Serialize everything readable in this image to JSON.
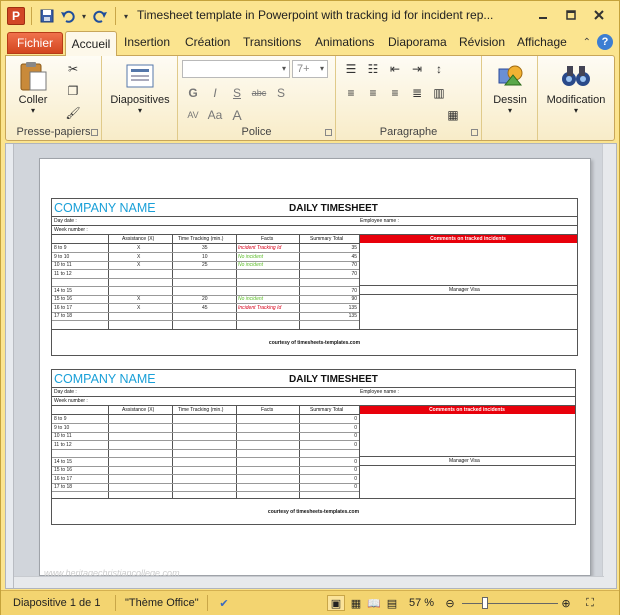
{
  "window": {
    "title": "Timesheet template in Powerpoint with tracking id for incident rep...",
    "app_logo": "P"
  },
  "qat": {
    "icons": [
      "save-icon",
      "undo-icon",
      "redo-icon",
      "customize-icon"
    ]
  },
  "tabs": {
    "fichier": "Fichier",
    "active": "Accueil",
    "items": [
      "Insertion",
      "Création",
      "Transitions",
      "Animations",
      "Diaporama",
      "Révision",
      "Affichage"
    ],
    "help": "?"
  },
  "ribbon": {
    "groups": {
      "clipboard": {
        "label": "Presse-papiers",
        "coller": "Coller"
      },
      "slides": {
        "diapositives": "Diapositives"
      },
      "font": {
        "label": "Police",
        "size": "7+",
        "letters": [
          "G",
          "I",
          "S",
          "abc",
          "S",
          "AV",
          "Aa"
        ]
      },
      "paragraph": {
        "label": "Paragraphe"
      },
      "drawing": {
        "dessin": "Dessin"
      },
      "editing": {
        "modification": "Modification"
      }
    }
  },
  "timesheet": {
    "company": "COMPANY NAME",
    "title": "DAILY TIMESHEET",
    "day_date": "Day date :",
    "week_number": "Week number :",
    "employee_name": "Employee name :",
    "columns": [
      "Assistance (X)",
      "Time Tracking (min.)",
      "Facts",
      "Summary Total"
    ],
    "comments_header": "Comments on tracked incidents",
    "manager_visa": "Manager Visa",
    "courtesy": "courtesy of timesheets-templates.com"
  },
  "sheet1": {
    "rows": [
      {
        "time": "8 to 9",
        "assist": "X",
        "tracking": "35",
        "fact": "Incident Tracking Id",
        "fact_color": "red",
        "total": "35"
      },
      {
        "time": "9 to 10",
        "assist": "X",
        "tracking": "10",
        "fact": "No incident",
        "fact_color": "green",
        "total": "45"
      },
      {
        "time": "10 to 11",
        "assist": "X",
        "tracking": "25",
        "fact": "No incident",
        "fact_color": "green",
        "total": "70"
      },
      {
        "time": "11 to 12",
        "assist": "",
        "tracking": "",
        "fact": "",
        "fact_color": "",
        "total": "70"
      },
      {
        "time": "",
        "assist": "",
        "tracking": "",
        "fact": "",
        "fact_color": "",
        "total": ""
      },
      {
        "time": "14 to 15",
        "assist": "",
        "tracking": "",
        "fact": "",
        "fact_color": "",
        "total": "70"
      },
      {
        "time": "15 to 16",
        "assist": "X",
        "tracking": "20",
        "fact": "No incident",
        "fact_color": "green",
        "total": "90"
      },
      {
        "time": "16 to 17",
        "assist": "X",
        "tracking": "45",
        "fact": "Incident Tracking Id",
        "fact_color": "red",
        "total": "135"
      },
      {
        "time": "17 to 18",
        "assist": "",
        "tracking": "",
        "fact": "",
        "fact_color": "",
        "total": "135"
      }
    ]
  },
  "sheet2": {
    "rows": [
      {
        "time": "8 to 9",
        "total": "0"
      },
      {
        "time": "9 to 10",
        "total": "0"
      },
      {
        "time": "10 to 11",
        "total": "0"
      },
      {
        "time": "11 to 12",
        "total": "0"
      },
      {
        "time": "",
        "total": ""
      },
      {
        "time": "14 to 15",
        "total": "0"
      },
      {
        "time": "15 to 16",
        "total": "0"
      },
      {
        "time": "16 to 17",
        "total": "0"
      },
      {
        "time": "17 to 18",
        "total": "0"
      }
    ]
  },
  "watermark": "www.heritagechristiancollege.com",
  "statusbar": {
    "slide": "Diapositive 1 de 1",
    "theme": "\"Thème Office\"",
    "zoom": "57 %"
  }
}
